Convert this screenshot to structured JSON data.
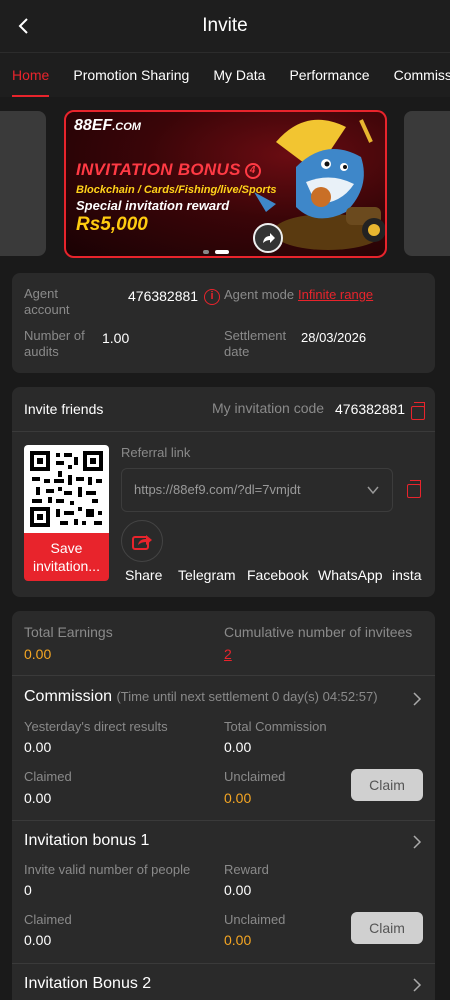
{
  "header": {
    "title": "Invite"
  },
  "tabs": [
    "Home",
    "Promotion Sharing",
    "My Data",
    "Performance",
    "Commission"
  ],
  "banner": {
    "brand": "88EF",
    "brand_suffix": ".COM",
    "headline": "INVITATION BONUS",
    "badge": "4",
    "subline": "Blockchain / Cards/Fishing/live/Sports",
    "special": "Special invitation reward",
    "amount": "Rs5,000"
  },
  "agent": {
    "account_label": "Agent account",
    "account_value": "476382881",
    "mode_label": "Agent mode",
    "mode_value": "Infinite range",
    "audits_label": "Number of audits",
    "audits_value": "1.00",
    "settlement_label": "Settlement date",
    "settlement_value": "28/03/2026"
  },
  "invite": {
    "title": "Invite friends",
    "code_label": "My invitation code",
    "code_value": "476382881",
    "save_label": "Save invitation...",
    "referral_label": "Referral link",
    "referral_value": "https://88ef9.com/?dl=7vmjdt",
    "share_targets": [
      "Share",
      "Telegram",
      "Facebook",
      "WhatsApp",
      "instag"
    ]
  },
  "earnings": {
    "total_label": "Total Earnings",
    "total_value": "0.00",
    "invitees_label": "Cumulative number of invitees",
    "invitees_value": "2"
  },
  "commission": {
    "title": "Commission",
    "note": "(Time until next settlement  0 day(s) 04:52:57)",
    "yesterday_label": "Yesterday's direct results",
    "yesterday_value": "0.00",
    "total_label": "Total Commission",
    "total_value": "0.00",
    "claimed_label": "Claimed",
    "claimed_value": "0.00",
    "unclaimed_label": "Unclaimed",
    "unclaimed_value": "0.00",
    "claim_label": "Claim"
  },
  "bonus1": {
    "title": "Invitation bonus 1",
    "valid_label": "Invite valid number of people",
    "valid_value": "0",
    "reward_label": "Reward",
    "reward_value": "0.00",
    "claimed_label": "Claimed",
    "claimed_value": "0.00",
    "unclaimed_label": "Unclaimed",
    "unclaimed_value": "0.00",
    "claim_label": "Claim"
  },
  "bonus2": {
    "title": "Invitation Bonus 2"
  },
  "colors": {
    "accent": "#e8242c",
    "orange": "#f5a623",
    "card": "#2a2a2a",
    "background": "#1a1a1a"
  },
  "icons": {
    "back": "chevron-left-icon",
    "copy": "copy-icon",
    "info": "info-icon",
    "share": "share-icon",
    "dropdown": "chevron-down-icon",
    "expand": "chevron-right-icon"
  }
}
